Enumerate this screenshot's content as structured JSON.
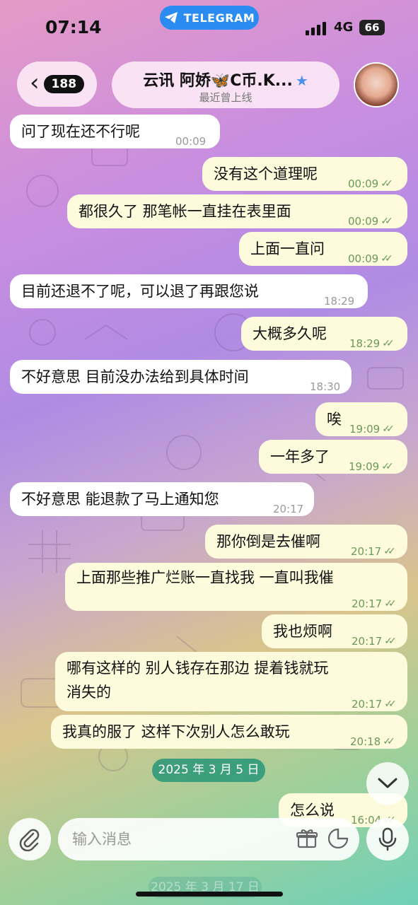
{
  "status_bar": {
    "time": "07:14",
    "app_pill": "TELEGRAM",
    "network": "4G",
    "battery": "66"
  },
  "header": {
    "back_count": "188",
    "title": "云讯 阿娇🦋C币.K...",
    "subtitle": "最近曾上线"
  },
  "messages": [
    {
      "dir": "in",
      "text": "问了现在还不行呢",
      "time": "00:09"
    },
    {
      "dir": "out",
      "text": "没有这个道理呢",
      "time": "00:09"
    },
    {
      "dir": "out",
      "text": "都很久了 那笔帐一直挂在表里面",
      "time": "00:09"
    },
    {
      "dir": "out",
      "text": "上面一直问",
      "time": "00:09"
    },
    {
      "dir": "in",
      "text": "目前还退不了呢，可以退了再跟您说",
      "time": "18:29"
    },
    {
      "dir": "out",
      "text": "大概多久呢",
      "time": "18:29"
    },
    {
      "dir": "in",
      "text": "不好意思 目前没办法给到具体时间",
      "time": "18:30"
    },
    {
      "dir": "out",
      "text": "唉",
      "time": "19:09"
    },
    {
      "dir": "out",
      "text": "一年多了",
      "time": "19:09"
    },
    {
      "dir": "in",
      "text": "不好意思 能退款了马上通知您",
      "time": "20:17"
    },
    {
      "dir": "out",
      "text": "那你倒是去催啊",
      "time": "20:17"
    },
    {
      "dir": "out",
      "text": "上面那些推广烂账一直找我 一直叫我催",
      "time": "20:17"
    },
    {
      "dir": "out",
      "text": "我也烦啊",
      "time": "20:17"
    },
    {
      "dir": "out",
      "text": "哪有这样的 别人钱存在那边 提着钱就玩",
      "text2": "消失的",
      "time": "20:17"
    },
    {
      "dir": "out",
      "text": "我真的服了 这样下次别人怎么敢玩",
      "time": "20:18"
    },
    {
      "dir": "out",
      "text": "怎么说",
      "time": "16:04"
    }
  ],
  "date_separator": "2025 年 3 月 5 日",
  "date_separator_next": "2025 年 3 月 17 日",
  "composer": {
    "placeholder": "输入消息"
  },
  "colors": {
    "incoming_bubble": "#ffffff",
    "outgoing_bubble": "#fefbdd",
    "outgoing_meta": "#6a9a5a",
    "telegram_blue": "#2a8cf0",
    "date_pill": "#2a9678"
  },
  "icons": [
    "back-chevron-icon",
    "verified-star-icon",
    "paperclip-icon",
    "gift-icon",
    "sticker-icon",
    "microphone-icon",
    "chevron-down-icon",
    "read-ticks-icon",
    "telegram-plane-icon"
  ]
}
